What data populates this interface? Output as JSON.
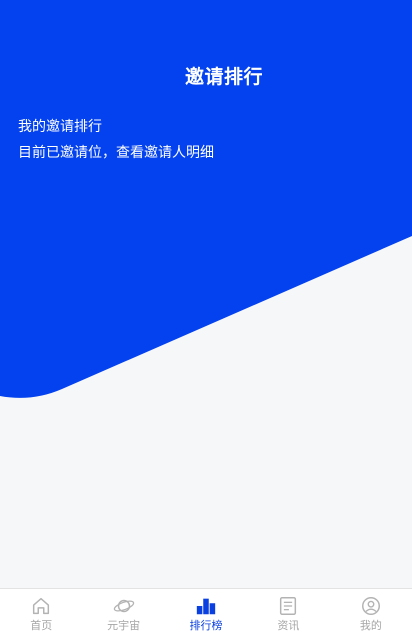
{
  "colors": {
    "primary": "#0342ee",
    "page_background": "#f6f7f9",
    "tab_inactive": "#a6a6a6",
    "tab_active": "#0a3fe0"
  },
  "header": {
    "title": "邀请排行"
  },
  "intro": {
    "line1": "我的邀请排行",
    "line2": "目前已邀请位，查看邀请人明细"
  },
  "tabbar": {
    "tabs": [
      {
        "label": "首页",
        "icon": "home-icon",
        "active": false
      },
      {
        "label": "元宇宙",
        "icon": "planet-icon",
        "active": false
      },
      {
        "label": "排行榜",
        "icon": "ranking-icon",
        "active": true
      },
      {
        "label": "资讯",
        "icon": "news-icon",
        "active": false
      },
      {
        "label": "我的",
        "icon": "profile-icon",
        "active": false
      }
    ]
  }
}
